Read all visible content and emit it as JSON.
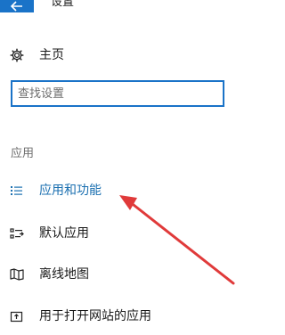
{
  "window": {
    "title": "设置",
    "accent_color": "#1a73c8"
  },
  "nav": {
    "back_icon": "arrow-left-icon",
    "home": {
      "label": "主页",
      "icon": "gear-icon"
    },
    "search": {
      "placeholder": "查找设置",
      "value": ""
    }
  },
  "section": {
    "header": "应用",
    "items": [
      {
        "label": "应用和功能",
        "icon": "list-icon",
        "selected": true
      },
      {
        "label": "默认应用",
        "icon": "default-apps-icon",
        "selected": false
      },
      {
        "label": "离线地图",
        "icon": "map-icon",
        "selected": false
      },
      {
        "label": "用于打开网站的应用",
        "icon": "open-link-icon",
        "selected": false
      }
    ]
  },
  "annotation": {
    "type": "arrow",
    "color": "#e03a3a",
    "points_to": "应用和功能"
  }
}
